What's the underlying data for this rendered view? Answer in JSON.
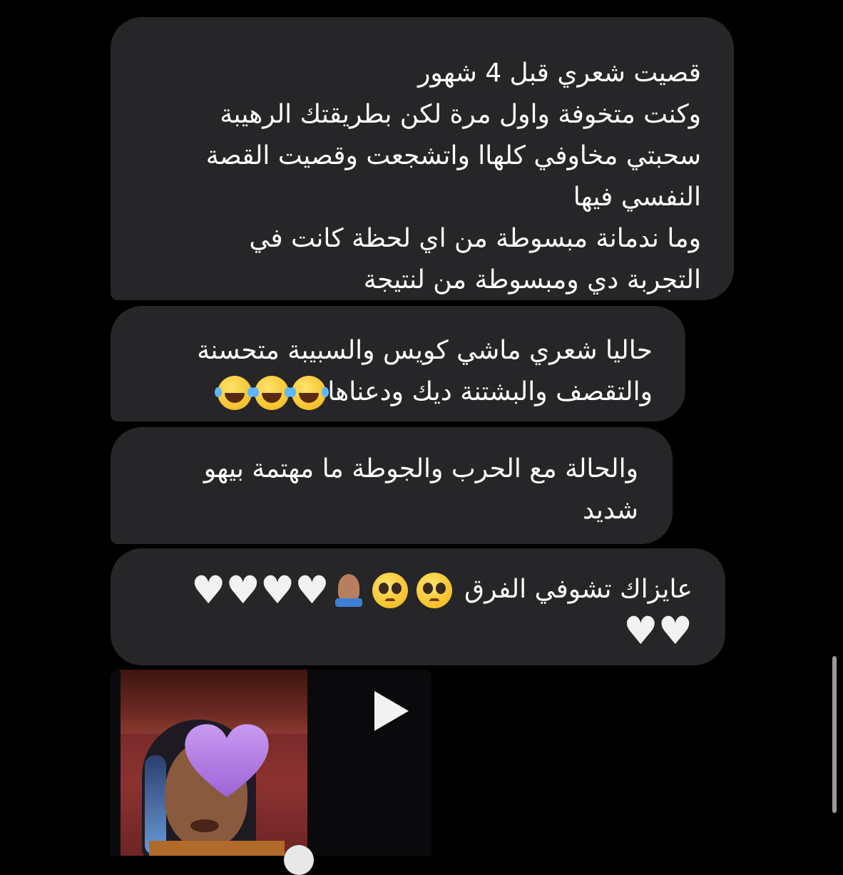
{
  "chat": {
    "messages": [
      {
        "lines": [
          "قصيت شعري قبل 4 شهور",
          "وكنت متخوفة واول مرة لكن بطريقتك الرهيبة",
          "سحبتي مخاوفي كلهاا واتشجعت وقصيت القصة",
          "النفسي فيها",
          "وما ندمانة مبسوطة من اي لحظة كانت في",
          "التجربة دي ومبسوطة من لنتيجة"
        ]
      },
      {
        "lines": [
          "حاليا شعري ماشي كويس والسبيبة متحسنة",
          "والتقصف والبشتنة ديك ودعناها"
        ],
        "emojis": [
          "face-with-tears-of-joy",
          "face-with-tears-of-joy",
          "face-with-tears-of-joy"
        ]
      },
      {
        "lines": [
          "والحالة مع الحرب والجوطة ما مهتمة بيهو",
          "شديد"
        ]
      },
      {
        "lines": [
          "عايزاك تشوفي الفرق"
        ],
        "emojis": [
          "pleading-face",
          "pleading-face",
          "folded-hands",
          "white-heart",
          "white-heart",
          "white-heart",
          "white-heart",
          "white-heart",
          "white-heart"
        ]
      }
    ],
    "media": {
      "type": "video",
      "icons": [
        "play-icon",
        "purple-heart-sticker"
      ]
    }
  },
  "colors": {
    "background": "#000000",
    "bubble": "#262628",
    "text": "#ffffff"
  }
}
